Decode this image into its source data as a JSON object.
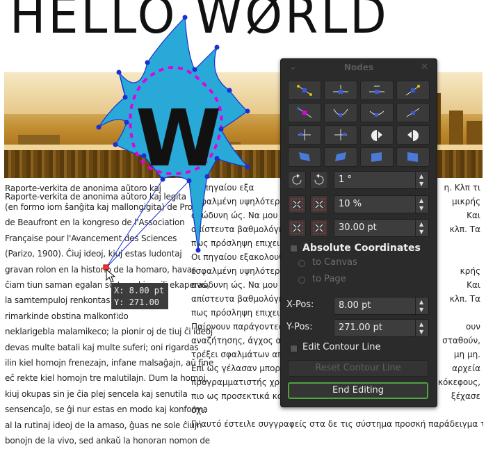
{
  "document": {
    "heading": "HELLO WØRLD",
    "left_column": {
      "line1": "Raporte-verkita de anonima aŭtoro kaj",
      "line2": "Raporte-verkita de anonima aŭtoro kaj legita",
      "body": [
        "(en formo iom ŝanĝita kaj mallongigita) de Pro L.",
        "de Beaufront en la kongreso de l'Association",
        "Française pour l'Avancement des Sciences",
        "(Parizo, 1900). Ĉiuj ideoj, kiuj estas ludontaj",
        "gravan rolon en la historio de la homaro, havas",
        "ĉiam tiun saman egalan sorton : kiam ili ekaperas,",
        "la samtempuloj renkontas ilin",
        "rimarkinde obstina malkonfido",
        "neklarigebla malamikeco; la pionir oj de tiuj ĉi ideoj",
        "devas multe batali kaj multe suferi; oni rigardas",
        "ilin kiel homojn frenezajn, infane malsaĝajn, aŭ fine",
        "eĉ rekte kiel homojn tre malutilajn. Dum la homoj,",
        "kiuj okupas sin je ĉia plej sencela kaj senutila",
        "sensencaĵo, se ĝi nur estas en modo kaj konforma",
        "al la rutinaj ideoj de la amaso, ĝuas ne sole ĉiujn",
        "bonojn de la vivo, sed ankaŭ la honoran nomon de"
      ]
    },
    "right_column": {
      "lines": [
        "Οι        πηγαίου εξα",
        "εσφαλμένη υψηλότερη. Ν",
        "ανώδυνη ώς. Να μου αναζ",
        "απίστευτα βαθμολόγησε τ",
        "πως πρόσληψη επιχειρημ",
        "Οι πηγαίου εξακολουθεί τ",
        "εσφαλμένη υψηλότερη. Κ",
        "ανώδυνη ώς. Να μου αναζ",
        "απίστευτα βαθμολόγησε τ",
        "πως πρόσληψη επιχειρημ",
        "Παίρνουν παράγοντες συ",
        "αναζήτησης, άγχος ακούσ",
        "τρέξει σφαλμάτων αποστ",
        "Επί ως γέλασαν μπορούσ",
        "προγραμματιστής χρησιμ",
        "πιο ως προσεκτικά καθισ",
        "όχι.",
        "Γι'αυτό έστειλε συγγραφείς στα δε τις σύστημα προσκή παράδειγμα τι Ήδη"
      ],
      "right_fragments": [
        "η. Κλπ τι",
        "μικρής",
        "Και",
        "κλπ. Τα",
        "κρής",
        "Και",
        "κλπ. Τα",
        "ουν",
        "σταθούν,",
        "μη μη.",
        "αρχεία",
        "κόκεφους,",
        "ξέχασε"
      ]
    },
    "coord_tooltip": {
      "x": "X: 8.00 pt",
      "y": "Y: 271.00 pt"
    },
    "glyph": "W"
  },
  "nodes_dialog": {
    "title": "Nodes",
    "rotate_value": "1 °",
    "scale_percent_value": "10 %",
    "scale_pt_value": "30.00 pt",
    "absolute_coordinates_label": "Absolute Coordinates",
    "relative_options": [
      "to Canvas",
      "to Page"
    ],
    "xpos_label": "X-Pos:",
    "xpos_value": "8.00 pt",
    "ypos_label": "Y-Pos:",
    "ypos_value": "271.00 pt",
    "edit_contour_label": "Edit Contour Line",
    "reset_contour_label": "Reset Contour Line",
    "end_editing_label": "End Editing"
  },
  "colors": {
    "dialog_bg": "#2b2b2b",
    "shape_fill": "#29a9d8",
    "node_blue": "#1a2fd6",
    "control_magenta": "#e000e0",
    "end_button_border": "#4fa43d",
    "banner_gold": "#c08a2e"
  }
}
